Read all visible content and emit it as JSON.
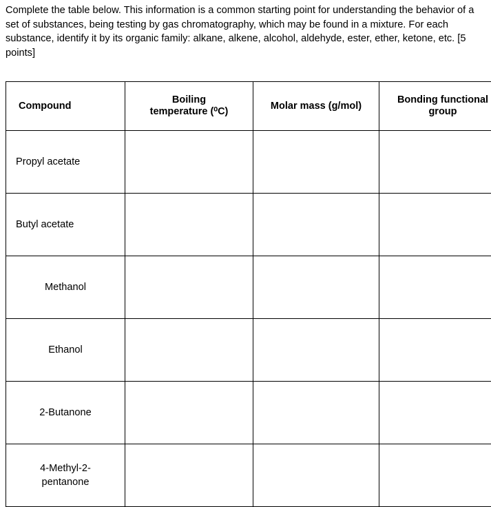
{
  "document": {
    "instructions": "Complete the table below. This information is a common starting point for understanding the behavior of a set of substances, being testing by gas chromatography, which may be found in a mixture. For each substance, identify it by its organic family: alkane, alkene, alcohol, aldehyde, ester, ether, ketone, etc. [5 points]",
    "table": {
      "headers": [
        {
          "line1": "Compound",
          "line2": ""
        },
        {
          "line1": "Boiling",
          "line2": "temperature (⁰C)"
        },
        {
          "line1": "Molar mass (g/mol)",
          "line2": ""
        },
        {
          "line1": "Bonding functional",
          "line2": "group"
        }
      ],
      "rows": [
        {
          "compound_line1": "Propyl acetate",
          "compound_line2": "",
          "boiling": "",
          "molar": "",
          "bonding": ""
        },
        {
          "compound_line1": "Butyl acetate",
          "compound_line2": "",
          "boiling": "",
          "molar": "",
          "bonding": ""
        },
        {
          "compound_line1": "Methanol",
          "compound_line2": "",
          "boiling": "",
          "molar": "",
          "bonding": ""
        },
        {
          "compound_line1": "Ethanol",
          "compound_line2": "",
          "boiling": "",
          "molar": "",
          "bonding": ""
        },
        {
          "compound_line1": "2-Butanone",
          "compound_line2": "",
          "boiling": "",
          "molar": "",
          "bonding": ""
        },
        {
          "compound_line1": "4-Methyl-2-",
          "compound_line2": "pentanone",
          "boiling": "",
          "molar": "",
          "bonding": ""
        }
      ]
    }
  }
}
